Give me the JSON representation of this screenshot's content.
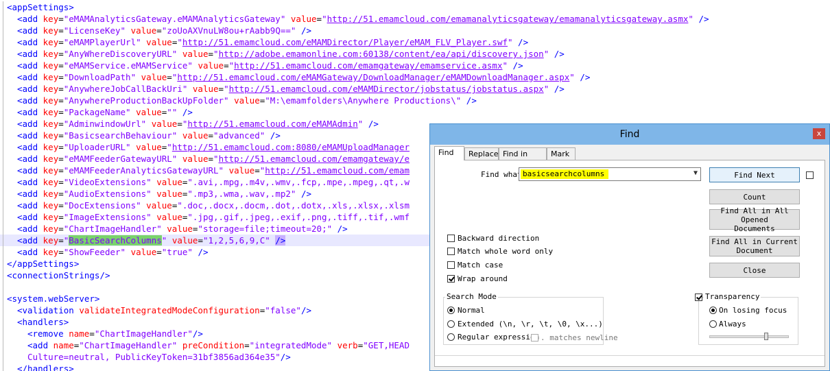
{
  "editor": {
    "lines": [
      {
        "i": 0,
        "t": [
          [
            "tag",
            "<appSettings>"
          ]
        ]
      },
      {
        "i": 1,
        "t": [
          [
            "tag",
            "<add "
          ],
          [
            "attr",
            "key"
          ],
          [
            "eq",
            "="
          ],
          [
            "val",
            "\"eMAMAnalyticsGateway.eMAMAnalyticsGateway\""
          ],
          [
            "eq",
            " "
          ],
          [
            "attr",
            "value"
          ],
          [
            "eq",
            "="
          ],
          [
            "val",
            "\""
          ],
          [
            "url",
            "http://51.emamcloud.com/emamanalyticsgateway/emamanalyticsgateway.asmx"
          ],
          [
            "val",
            "\""
          ],
          [
            "tag",
            " />"
          ]
        ]
      },
      {
        "i": 1,
        "t": [
          [
            "tag",
            "<add "
          ],
          [
            "attr",
            "key"
          ],
          [
            "eq",
            "="
          ],
          [
            "val",
            "\"LicenseKey\""
          ],
          [
            "eq",
            " "
          ],
          [
            "attr",
            "value"
          ],
          [
            "eq",
            "="
          ],
          [
            "val",
            "\"zoUoAXVnuLW8ou+rAabb9Q==\""
          ],
          [
            "tag",
            " />"
          ]
        ]
      },
      {
        "i": 1,
        "t": [
          [
            "tag",
            "<add "
          ],
          [
            "attr",
            "key"
          ],
          [
            "eq",
            "="
          ],
          [
            "val",
            "\"eMAMPlayerUrl\""
          ],
          [
            "eq",
            " "
          ],
          [
            "attr",
            "value"
          ],
          [
            "eq",
            "="
          ],
          [
            "val",
            "\""
          ],
          [
            "url",
            "http://51.emamcloud.com/eMAMDirector/Player/eMAM_FLV_Player.swf"
          ],
          [
            "val",
            "\""
          ],
          [
            "tag",
            " />"
          ]
        ]
      },
      {
        "i": 1,
        "t": [
          [
            "tag",
            "<add "
          ],
          [
            "attr",
            "key"
          ],
          [
            "eq",
            "="
          ],
          [
            "val",
            "\"AnyWhereDiscoveryURL\""
          ],
          [
            "eq",
            " "
          ],
          [
            "attr",
            "value"
          ],
          [
            "eq",
            "="
          ],
          [
            "val",
            "\""
          ],
          [
            "url",
            "http://adobe.emamonline.com:60138/content/ea/api/discovery.json"
          ],
          [
            "val",
            "\""
          ],
          [
            "tag",
            " />"
          ]
        ]
      },
      {
        "i": 1,
        "t": [
          [
            "tag",
            "<add "
          ],
          [
            "attr",
            "key"
          ],
          [
            "eq",
            "="
          ],
          [
            "val",
            "\"eMAMService.eMAMService\""
          ],
          [
            "eq",
            " "
          ],
          [
            "attr",
            "value"
          ],
          [
            "eq",
            "="
          ],
          [
            "val",
            "\""
          ],
          [
            "url",
            "http://51.emamcloud.com/emamgateway/emamservice.asmx"
          ],
          [
            "val",
            "\""
          ],
          [
            "tag",
            " />"
          ]
        ]
      },
      {
        "i": 1,
        "t": [
          [
            "tag",
            "<add "
          ],
          [
            "attr",
            "key"
          ],
          [
            "eq",
            "="
          ],
          [
            "val",
            "\"DownloadPath\""
          ],
          [
            "eq",
            " "
          ],
          [
            "attr",
            "value"
          ],
          [
            "eq",
            "="
          ],
          [
            "val",
            "\""
          ],
          [
            "url",
            "http://51.emamcloud.com/eMAMGateway/DownloadManager/eMAMDownloadManager.aspx"
          ],
          [
            "val",
            "\""
          ],
          [
            "tag",
            " />"
          ]
        ]
      },
      {
        "i": 1,
        "t": [
          [
            "tag",
            "<add "
          ],
          [
            "attr",
            "key"
          ],
          [
            "eq",
            "="
          ],
          [
            "val",
            "\"AnywhereJobCallBackUri\""
          ],
          [
            "eq",
            " "
          ],
          [
            "attr",
            "value"
          ],
          [
            "eq",
            "="
          ],
          [
            "val",
            "\""
          ],
          [
            "url",
            "http://51.emamcloud.com/eMAMDirector/jobstatus/jobstatus.aspx"
          ],
          [
            "val",
            "\""
          ],
          [
            "tag",
            " />"
          ]
        ]
      },
      {
        "i": 1,
        "t": [
          [
            "tag",
            "<add "
          ],
          [
            "attr",
            "key"
          ],
          [
            "eq",
            "="
          ],
          [
            "val",
            "\"AnywhereProductionBackUpFolder\""
          ],
          [
            "eq",
            " "
          ],
          [
            "attr",
            "value"
          ],
          [
            "eq",
            "="
          ],
          [
            "val",
            "\"M:\\emamfolders\\Anywhere Productions\\\""
          ],
          [
            "tag",
            " />"
          ]
        ]
      },
      {
        "i": 1,
        "t": [
          [
            "tag",
            "<add "
          ],
          [
            "attr",
            "key"
          ],
          [
            "eq",
            "="
          ],
          [
            "val",
            "\"PackageName\""
          ],
          [
            "eq",
            " "
          ],
          [
            "attr",
            "value"
          ],
          [
            "eq",
            "="
          ],
          [
            "val",
            "\"\""
          ],
          [
            "tag",
            " />"
          ]
        ]
      },
      {
        "i": 1,
        "t": [
          [
            "tag",
            "<add "
          ],
          [
            "attr",
            "key"
          ],
          [
            "eq",
            "="
          ],
          [
            "val",
            "\"AdminwindowUrl\""
          ],
          [
            "eq",
            " "
          ],
          [
            "attr",
            "value"
          ],
          [
            "eq",
            "="
          ],
          [
            "val",
            "\""
          ],
          [
            "url",
            "http://51.emamcloud.com/eMAMAdmin"
          ],
          [
            "val",
            "\""
          ],
          [
            "tag",
            " />"
          ]
        ]
      },
      {
        "i": 1,
        "t": [
          [
            "tag",
            "<add "
          ],
          [
            "attr",
            "key"
          ],
          [
            "eq",
            "="
          ],
          [
            "val",
            "\"BasicsearchBehaviour\""
          ],
          [
            "eq",
            " "
          ],
          [
            "attr",
            "value"
          ],
          [
            "eq",
            "="
          ],
          [
            "val",
            "\"advanced\""
          ],
          [
            "tag",
            " />"
          ]
        ]
      },
      {
        "i": 1,
        "t": [
          [
            "tag",
            "<add "
          ],
          [
            "attr",
            "key"
          ],
          [
            "eq",
            "="
          ],
          [
            "val",
            "\"UploaderURL\""
          ],
          [
            "eq",
            " "
          ],
          [
            "attr",
            "value"
          ],
          [
            "eq",
            "="
          ],
          [
            "val",
            "\""
          ],
          [
            "url",
            "http://51.emamcloud.com:8080/eMAMUploadManager"
          ]
        ]
      },
      {
        "i": 1,
        "t": [
          [
            "tag",
            "<add "
          ],
          [
            "attr",
            "key"
          ],
          [
            "eq",
            "="
          ],
          [
            "val",
            "\"eMAMFeederGatewayURL\""
          ],
          [
            "eq",
            " "
          ],
          [
            "attr",
            "value"
          ],
          [
            "eq",
            "="
          ],
          [
            "val",
            "\""
          ],
          [
            "url",
            "http://51.emamcloud.com/emamgateway/e"
          ]
        ]
      },
      {
        "i": 1,
        "t": [
          [
            "tag",
            "<add "
          ],
          [
            "attr",
            "key"
          ],
          [
            "eq",
            "="
          ],
          [
            "val",
            "\"eMAMFeederAnalyticsGatewayURL\""
          ],
          [
            "eq",
            " "
          ],
          [
            "attr",
            "value"
          ],
          [
            "eq",
            "="
          ],
          [
            "val",
            "\""
          ],
          [
            "url",
            "http://51.emamcloud.com/emam"
          ]
        ]
      },
      {
        "i": 1,
        "t": [
          [
            "tag",
            "<add "
          ],
          [
            "attr",
            "key"
          ],
          [
            "eq",
            "="
          ],
          [
            "val",
            "\"VideoExtensions\""
          ],
          [
            "eq",
            " "
          ],
          [
            "attr",
            "value"
          ],
          [
            "eq",
            "="
          ],
          [
            "val",
            "\".avi,.mpg,.m4v,.wmv,.fcp,.mpe,.mpeg,.qt,.w"
          ]
        ]
      },
      {
        "i": 1,
        "t": [
          [
            "tag",
            "<add "
          ],
          [
            "attr",
            "key"
          ],
          [
            "eq",
            "="
          ],
          [
            "val",
            "\"AudioExtensions\""
          ],
          [
            "eq",
            " "
          ],
          [
            "attr",
            "value"
          ],
          [
            "eq",
            "="
          ],
          [
            "val",
            "\".mp3,.wma,.wav,.mp2\""
          ],
          [
            "tag",
            " />"
          ]
        ]
      },
      {
        "i": 1,
        "t": [
          [
            "tag",
            "<add "
          ],
          [
            "attr",
            "key"
          ],
          [
            "eq",
            "="
          ],
          [
            "val",
            "\"DocExtensions\""
          ],
          [
            "eq",
            " "
          ],
          [
            "attr",
            "value"
          ],
          [
            "eq",
            "="
          ],
          [
            "val",
            "\".doc,.docx,.docm,.dot,.dotx,.xls,.xlsx,.xlsm"
          ]
        ]
      },
      {
        "i": 1,
        "t": [
          [
            "tag",
            "<add "
          ],
          [
            "attr",
            "key"
          ],
          [
            "eq",
            "="
          ],
          [
            "val",
            "\"ImageExtensions\""
          ],
          [
            "eq",
            " "
          ],
          [
            "attr",
            "value"
          ],
          [
            "eq",
            "="
          ],
          [
            "val",
            "\".jpg,.gif,.jpeg,.exif,.png,.tiff,.tif,.wmf"
          ]
        ]
      },
      {
        "i": 1,
        "t": [
          [
            "tag",
            "<add "
          ],
          [
            "attr",
            "key"
          ],
          [
            "eq",
            "="
          ],
          [
            "val",
            "\"ChartImageHandler\""
          ],
          [
            "eq",
            " "
          ],
          [
            "attr",
            "value"
          ],
          [
            "eq",
            "="
          ],
          [
            "val",
            "\"storage=file;timeout=20;\""
          ],
          [
            "tag",
            " />"
          ]
        ]
      },
      {
        "i": 1,
        "hl": true,
        "t": [
          [
            "tag",
            "<add "
          ],
          [
            "attr",
            "key"
          ],
          [
            "eq",
            "="
          ],
          [
            "val",
            "\""
          ],
          [
            "match",
            "BasicSearchColumns"
          ],
          [
            "val",
            "\""
          ],
          [
            "eq",
            " "
          ],
          [
            "attr",
            "value"
          ],
          [
            "eq",
            "="
          ],
          [
            "val",
            "\"1,2,5,6,9,C\""
          ],
          [
            "eq",
            " "
          ],
          [
            "brace",
            "/>"
          ]
        ]
      },
      {
        "i": 1,
        "t": [
          [
            "tag",
            "<add "
          ],
          [
            "attr",
            "key"
          ],
          [
            "eq",
            "="
          ],
          [
            "val",
            "\"ShowFeeder\""
          ],
          [
            "eq",
            " "
          ],
          [
            "attr",
            "value"
          ],
          [
            "eq",
            "="
          ],
          [
            "val",
            "\"true\""
          ],
          [
            "tag",
            " />"
          ]
        ]
      },
      {
        "i": 0,
        "t": [
          [
            "tag",
            "</appSettings>"
          ]
        ]
      },
      {
        "i": 0,
        "t": [
          [
            "tag",
            "<connectionStrings/>"
          ]
        ]
      },
      {
        "i": 0,
        "t": []
      },
      {
        "i": 0,
        "t": [
          [
            "tag",
            "<system.webServer>"
          ]
        ]
      },
      {
        "i": 1,
        "t": [
          [
            "tag",
            "<validation "
          ],
          [
            "attr",
            "validateIntegratedModeConfiguration"
          ],
          [
            "eq",
            "="
          ],
          [
            "val",
            "\"false\""
          ],
          [
            "tag",
            "/>"
          ]
        ]
      },
      {
        "i": 1,
        "t": [
          [
            "tag",
            "<handlers>"
          ]
        ]
      },
      {
        "i": 2,
        "t": [
          [
            "tag",
            "<remove "
          ],
          [
            "attr",
            "name"
          ],
          [
            "eq",
            "="
          ],
          [
            "val",
            "\"ChartImageHandler\""
          ],
          [
            "tag",
            "/>"
          ]
        ]
      },
      {
        "i": 2,
        "t": [
          [
            "tag",
            "<add "
          ],
          [
            "attr",
            "name"
          ],
          [
            "eq",
            "="
          ],
          [
            "val",
            "\"ChartImageHandler\""
          ],
          [
            "eq",
            " "
          ],
          [
            "attr",
            "preCondition"
          ],
          [
            "eq",
            "="
          ],
          [
            "val",
            "\"integratedMode\""
          ],
          [
            "eq",
            " "
          ],
          [
            "attr",
            "verb"
          ],
          [
            "eq",
            "="
          ],
          [
            "val",
            "\"GET,HEAD"
          ]
        ]
      },
      {
        "i": 2,
        "t": [
          [
            "val",
            "Culture=neutral, PublicKeyToken=31bf3856ad364e35\""
          ],
          [
            "tag",
            "/>"
          ]
        ]
      },
      {
        "i": 1,
        "t": [
          [
            "tag",
            "</handlers>"
          ]
        ]
      }
    ]
  },
  "dialog": {
    "title": "Find",
    "close_glyph": "x",
    "tabs": [
      "Find",
      "Replace",
      "Find in Files",
      "Mark"
    ],
    "find_what_label": "Find what :",
    "find_what_value": "basicsearchcolumns",
    "buttons": {
      "find_next": "Find Next",
      "count": "Count",
      "find_all_opened_1": "Find All in All Opened",
      "find_all_opened_2": "Documents",
      "find_all_current_1": "Find All in Current",
      "find_all_current_2": "Document",
      "close": "Close"
    },
    "options": {
      "backward": "Backward direction",
      "whole_word": "Match whole word only",
      "match_case": "Match case",
      "wrap_around": "Wrap around"
    },
    "search_mode": {
      "title": "Search Mode",
      "normal": "Normal",
      "extended": "Extended (\\n, \\r, \\t, \\0, \\x...)",
      "regex": "Regular expression",
      "matches_newline": ". matches newline"
    },
    "transparency": {
      "title": "Transparency",
      "on_losing_focus": "On losing focus",
      "always": "Always"
    }
  }
}
